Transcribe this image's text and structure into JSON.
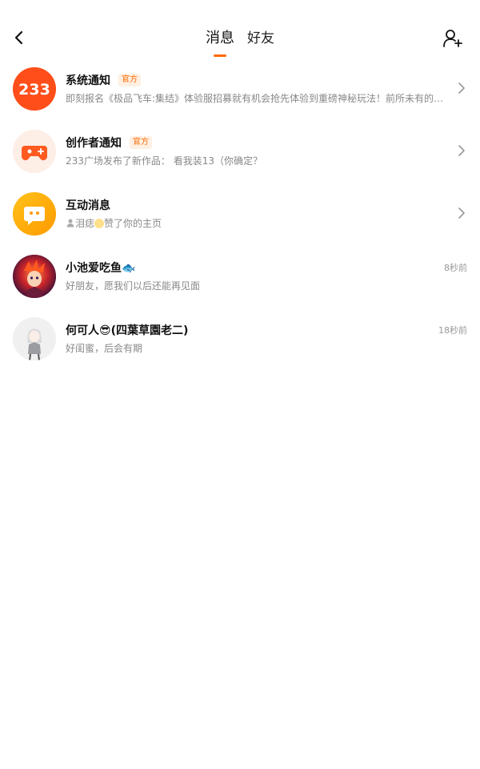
{
  "header": {
    "tabs": [
      {
        "label": "消息",
        "active": true
      },
      {
        "label": "好友",
        "active": false
      }
    ],
    "accent_color": "#ff6a00"
  },
  "messages": [
    {
      "title": "系统通知",
      "badge": "官方",
      "preview": "即刻报名《极品飞车:集结》体验服招募就有机会抢先体验到重磅神秘玩法！前所未有的竞...",
      "avatar_icon": "233-logo-icon",
      "avatar_text": "233"
    },
    {
      "title": "创作者通知",
      "badge": "官方",
      "preview": "233广场发布了新作品：  看我装13（你确定？",
      "avatar_icon": "gamepad-icon"
    },
    {
      "title": "互动消息",
      "preview_user1": "泪痣",
      "preview_rest": "赞了你的主页",
      "avatar_icon": "chat-bubble-icon"
    },
    {
      "title": "小池爱吃鱼🐟",
      "preview": "好朋友，愿我们以后还能再见面",
      "time": "8秒前",
      "avatar_icon": "anime-avatar-icon"
    },
    {
      "title": "何可人😎(四葉草園老二)",
      "preview": "好闺蜜，后会有期",
      "time": "18秒前",
      "avatar_icon": "anime-avatar-icon"
    }
  ]
}
